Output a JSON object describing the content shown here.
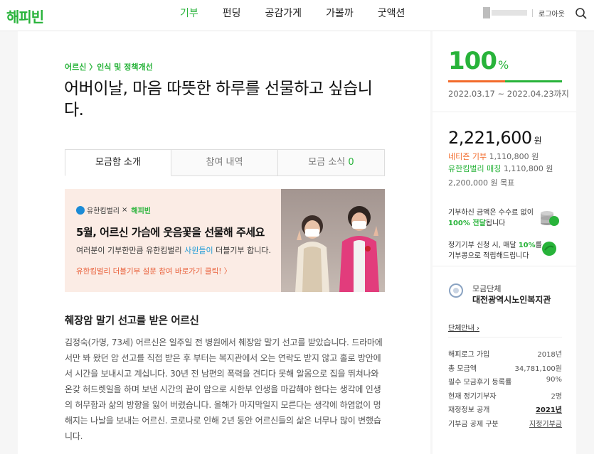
{
  "header": {
    "logo": "해피빈",
    "nav": [
      "기부",
      "펀딩",
      "공감가게",
      "가볼까",
      "굿액션"
    ],
    "logout": "로그아웃"
  },
  "campaign": {
    "category": "어르신 〉인식 및 정책개선",
    "title": "어버이날, 마음 따뜻한 하루를 선물하고 싶습니다.",
    "tabs": [
      {
        "label": "모금함 소개",
        "count": ""
      },
      {
        "label": "참여 내역",
        "count": ""
      },
      {
        "label": "모금 소식",
        "count": "0"
      }
    ]
  },
  "banner": {
    "partner": "유한킴벌리",
    "times": "×",
    "brand": "해피빈",
    "headline": "5월, 어르신 가슴에 웃음꽃을 선물해 주세요",
    "sub_before": "여러분이 기부한만큼 유한킴벌리 ",
    "sub_highlight": "사원들이",
    "sub_after": " 더블기부 합니다.",
    "link": "유한킴벌리 더블기부 설문 참여 바로가기 클릭! 〉"
  },
  "story": {
    "heading": "췌장암 말기 선고를 받은 어르신",
    "paragraph": "김정숙(가명, 73세) 어르신은 일주일 전 병원에서 췌장암 말기 선고를 받았습니다. 드라마에서만 봐 왔던 암 선고를 직접 받은 후 부터는 복지관에서 오는 연락도 받지 않고 홀로 방안에서 시간을 보내시고 계십니다. 30년 전 남편의 폭력을 견디다 못해 알몸으로 집을 뛰쳐나와 온갖 허드렛일을 하며 보낸 시간의 끝이 암으로 시한부 인생을 마감해야 한다는 생각에 인생의 허무함과 삶의 방향을 잃어 버렸습니다. 올해가 마지막일지 모른다는 생각에 하염없이 멍해지는 나날을 보내는 어르신. 코로나로 인해 2년 동안 어르신들의 삶은 너무나 많이 변했습니다."
  },
  "sidebar": {
    "percent": "100",
    "percent_unit": "%",
    "progress": 1.0,
    "period": "2022.03.17 ~ 2022.04.23",
    "period_suffix": "까지",
    "total": "2,221,600",
    "total_unit": "원",
    "donor_label": "네티즌 기부",
    "donor_amount": "1,110,800 원",
    "match_label": "유한킴벌리 매칭",
    "match_amount": "1,110,800 원",
    "goal": "2,200,000 원 목표",
    "info1_a": "기부하신 금액은 수수료 없이",
    "info1_b": "100% 전달",
    "info1_c": "됩니다",
    "info2_a": "정기기부 신청 시, 매달 ",
    "info2_b": "10%",
    "info2_c": "를",
    "info2_d": "기부콩으로 적립해드립니다",
    "org_sub": "모금단체",
    "org_name": "대전광역시노인복지관",
    "org_link": "단체안내",
    "stats": [
      {
        "label": "해피로그 가입",
        "value": "2018년"
      },
      {
        "label": "총 모금액",
        "value": "34,781,100원"
      },
      {
        "label": "필수 모금후기 등록률",
        "value": "90%"
      },
      {
        "label": "현재 정기기부자",
        "value": "2명"
      },
      {
        "label": "재정정보 공개",
        "value": "2021년"
      },
      {
        "label": "기부금 공제 구분",
        "value": "지정기부금"
      }
    ],
    "colors": {
      "green": "#28b33a",
      "orange": "#f26b2b"
    }
  }
}
